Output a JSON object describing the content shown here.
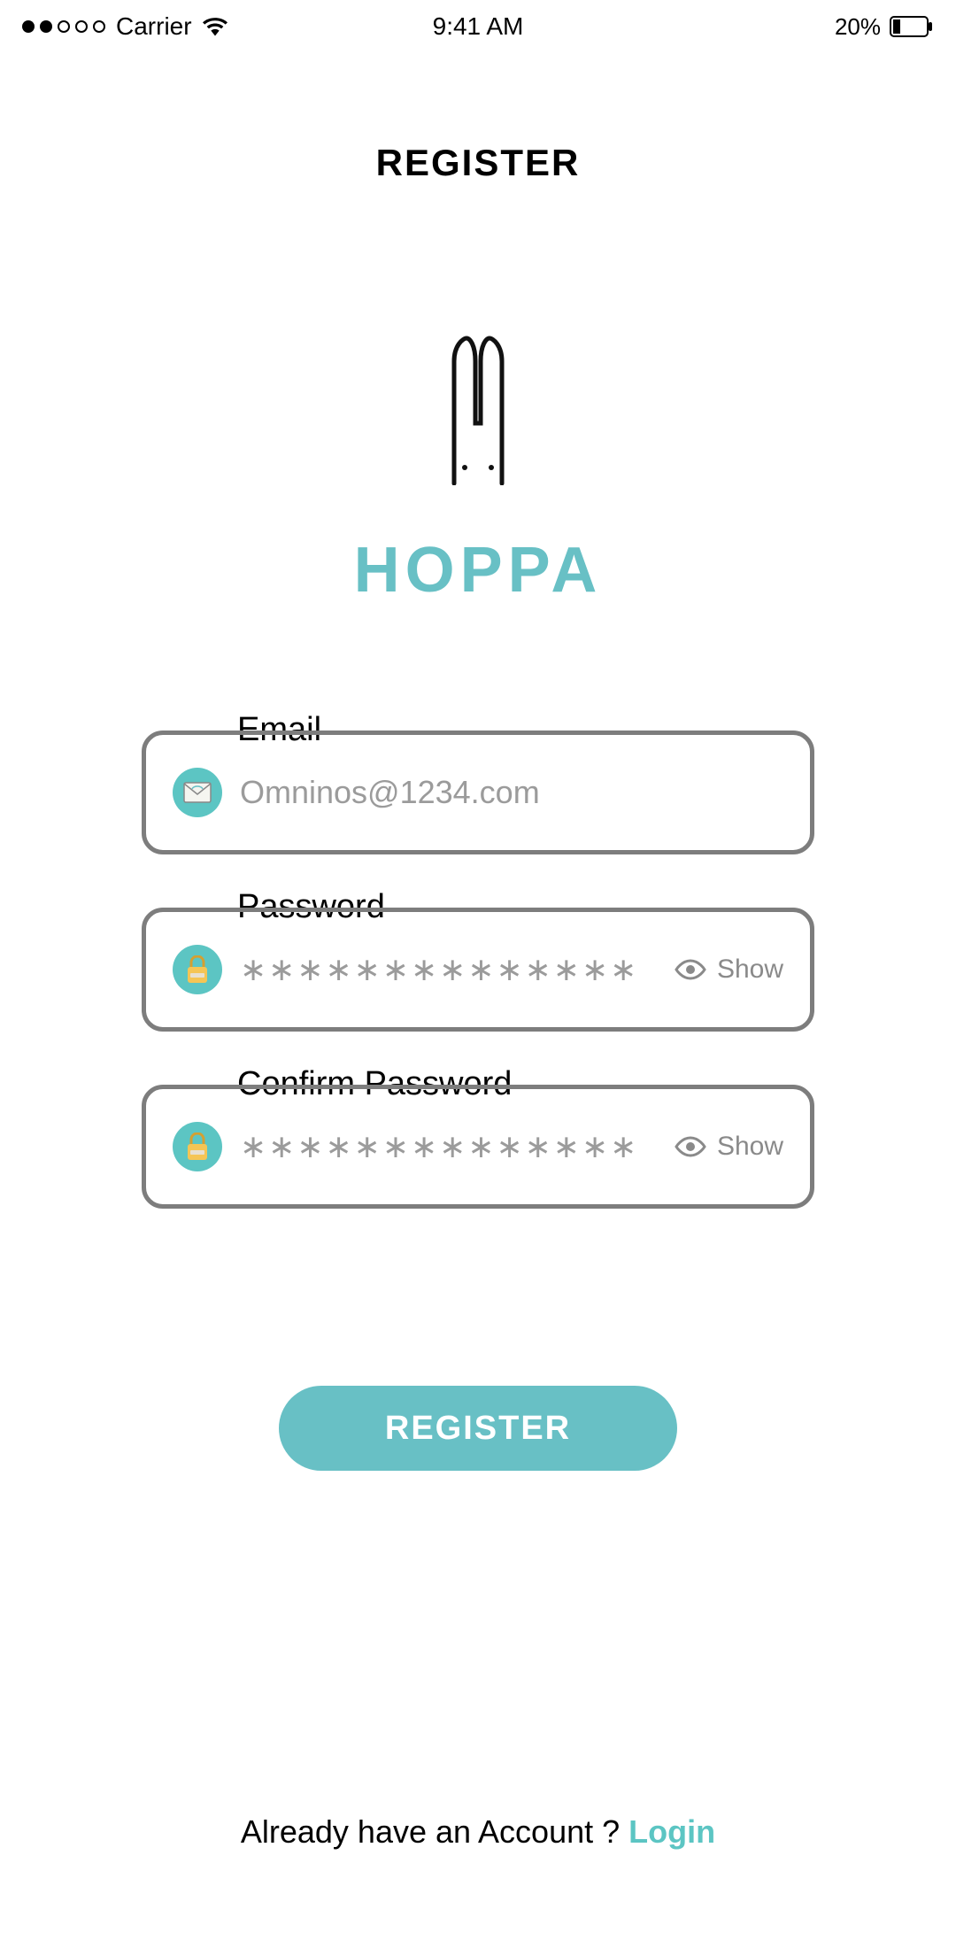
{
  "status_bar": {
    "carrier": "Carrier",
    "time": "9:41 AM",
    "battery_percent": "20%"
  },
  "header": {
    "title": "REGISTER"
  },
  "brand": {
    "name": "HOPPA"
  },
  "form": {
    "email": {
      "label": "Email",
      "placeholder": "Omninos@1234.com"
    },
    "password": {
      "label": "Password",
      "value": "∗∗∗∗∗∗∗∗∗∗∗∗∗∗",
      "show_label": "Show"
    },
    "confirm_password": {
      "label": "Confirm Password",
      "value": "∗∗∗∗∗∗∗∗∗∗∗∗∗∗",
      "show_label": "Show"
    },
    "submit_label": "REGISTER"
  },
  "footer": {
    "prompt": "Already have an Account ? ",
    "login_link": "Login"
  }
}
